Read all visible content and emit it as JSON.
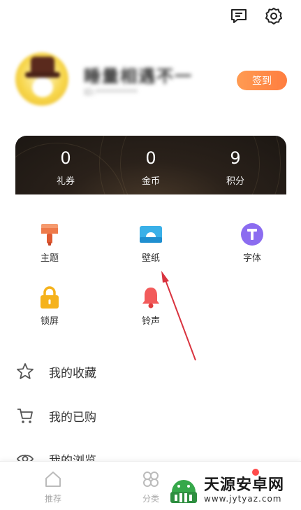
{
  "header": {
    "icons": [
      "message-icon",
      "settings-gear-icon"
    ]
  },
  "profile": {
    "nickname": "睡量相遇不一",
    "subtitle": "ID:**********",
    "signin_label": "签到"
  },
  "wallet": {
    "stats": [
      {
        "value": "0",
        "label": "礼券"
      },
      {
        "value": "0",
        "label": "金币"
      },
      {
        "value": "9",
        "label": "积分"
      }
    ]
  },
  "features": {
    "items": [
      {
        "label": "主题",
        "icon": "paint-brush-icon",
        "color": "#f08a5d"
      },
      {
        "label": "壁纸",
        "icon": "wallpaper-icon",
        "color": "#3ab0e8"
      },
      {
        "label": "字体",
        "icon": "font-T-icon",
        "color": "#8b6cf0"
      },
      {
        "label": "锁屏",
        "icon": "lock-icon",
        "color": "#f5b21c"
      },
      {
        "label": "铃声",
        "icon": "bell-icon",
        "color": "#f25b5b"
      }
    ]
  },
  "menu": {
    "items": [
      {
        "label": "我的收藏",
        "icon": "star-icon"
      },
      {
        "label": "我的已购",
        "icon": "cart-icon"
      },
      {
        "label": "我的浏览",
        "icon": "eye-icon"
      }
    ]
  },
  "tabbar": {
    "tabs": [
      {
        "label": "推荐",
        "icon": "home-icon"
      },
      {
        "label": "分类",
        "icon": "category-icon"
      }
    ]
  },
  "watermark": {
    "title": "天源安卓网",
    "url": "www.jytyaz.com"
  },
  "colors": {
    "accent": "#ff8a48",
    "wallet_bg": "#241c16",
    "annotation_arrow": "#d9333f"
  }
}
